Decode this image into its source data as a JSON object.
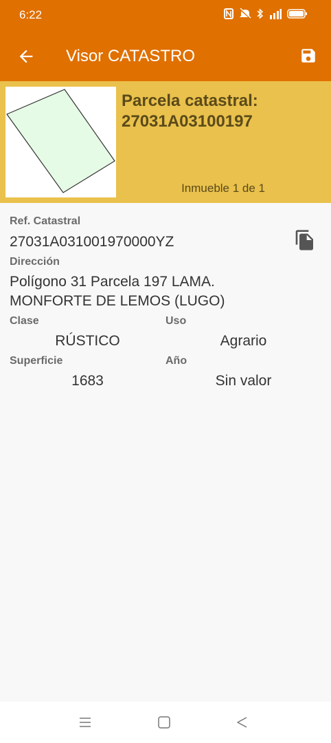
{
  "status_bar": {
    "time": "6:22",
    "icons": [
      "nfc-icon",
      "mute-icon",
      "bluetooth-icon",
      "signal-icon",
      "battery-icon"
    ]
  },
  "app_bar": {
    "title": "Visor CATASTRO",
    "back_icon": "arrow-left-icon",
    "save_icon": "save-icon",
    "color": "#e07000"
  },
  "header": {
    "parcel_label": "Parcela catastral:",
    "parcel_id": "27031A03100197",
    "inmueble": "Inmueble 1 de 1",
    "color": "#e9c14c"
  },
  "details": {
    "ref_label": "Ref. Catastral",
    "ref_value": "27031A031001970000YZ",
    "direccion_label": "Dirección",
    "direccion_line1": "Polígono 31 Parcela 197 LAMA.",
    "direccion_line2": "MONFORTE DE LEMOS (LUGO)",
    "clase_label": "Clase",
    "clase_value": "RÚSTICO",
    "uso_label": "Uso",
    "uso_value": "Agrario",
    "superficie_label": "Superficie",
    "superficie_value": "1683",
    "anio_label": "Año",
    "anio_value": "Sin valor"
  },
  "nav_bar": {
    "icons": [
      "menu-icon",
      "home-icon",
      "back-triangle-icon"
    ]
  }
}
